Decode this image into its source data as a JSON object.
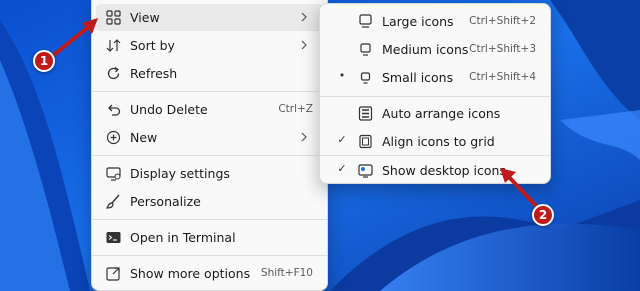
{
  "context_menu": {
    "items": [
      {
        "label": "View",
        "icon": "grid-icon",
        "has_submenu": true
      },
      {
        "label": "Sort by",
        "icon": "sort-icon",
        "has_submenu": true
      },
      {
        "label": "Refresh",
        "icon": "refresh-icon"
      },
      {
        "label": "Undo Delete",
        "icon": "undo-icon",
        "shortcut": "Ctrl+Z"
      },
      {
        "label": "New",
        "icon": "new-icon",
        "has_submenu": true
      },
      {
        "label": "Display settings",
        "icon": "display-icon"
      },
      {
        "label": "Personalize",
        "icon": "brush-icon"
      },
      {
        "label": "Open in Terminal",
        "icon": "terminal-icon"
      },
      {
        "label": "Show more options",
        "icon": "more-options-icon",
        "shortcut": "Shift+F10"
      }
    ]
  },
  "view_submenu": {
    "items": [
      {
        "label": "Large icons",
        "icon": "monitor-icon",
        "shortcut": "Ctrl+Shift+2"
      },
      {
        "label": "Medium icons",
        "icon": "monitor-icon",
        "shortcut": "Ctrl+Shift+3"
      },
      {
        "label": "Small icons",
        "icon": "monitor-icon",
        "shortcut": "Ctrl+Shift+4",
        "mark": "•"
      },
      {
        "label": "Auto arrange icons",
        "icon": "auto-arrange-icon"
      },
      {
        "label": "Align icons to grid",
        "icon": "align-grid-icon",
        "mark": "✓"
      },
      {
        "label": "Show desktop icons",
        "icon": "desktop-icon",
        "mark": "✓"
      }
    ]
  },
  "annotations": {
    "badge1": "1",
    "badge2": "2",
    "color": "#c01a1a"
  }
}
